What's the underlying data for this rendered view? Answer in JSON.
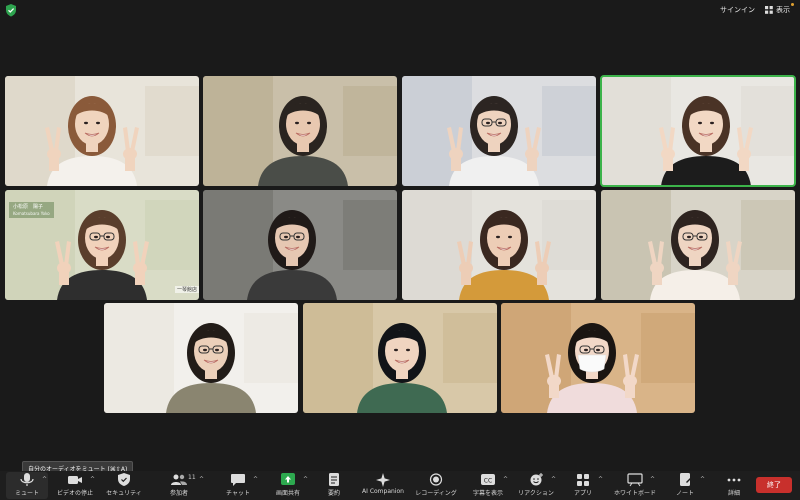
{
  "topbar": {
    "signin": "サインイン",
    "view": "表示",
    "view_icon": "grid-icon",
    "security_icon": "shield-icon"
  },
  "tiles": [
    {
      "bg": "#e8e4da",
      "wall": "#d9d2c2",
      "shirt": "#f4f1ec",
      "hair": "#8a5a3a",
      "skin": "#f0d4be",
      "glasses": false,
      "mask": false,
      "peace": true
    },
    {
      "bg": "#c9bfa9",
      "wall": "#b8ab8e",
      "shirt": "#4a4d48",
      "hair": "#2a2420",
      "skin": "#e8c8b0",
      "glasses": false,
      "mask": false,
      "peace": false
    },
    {
      "bg": "#dcdde0",
      "wall": "#c0c6ce",
      "shirt": "#f0f0f0",
      "hair": "#2c2522",
      "skin": "#eed3bf",
      "glasses": true,
      "mask": false,
      "peace": true
    },
    {
      "bg": "#e9e7e2",
      "wall": "#dddad2",
      "shirt": "#1c1c1c",
      "hair": "#4a3326",
      "skin": "#f2d8c4",
      "glasses": false,
      "mask": false,
      "peace": true,
      "active": true
    },
    {
      "bg": "#d9dcc6",
      "wall": "#c9cfb2",
      "shirt": "#2e2e2e",
      "hair": "#5a3e2c",
      "skin": "#f1d2bb",
      "glasses": true,
      "mask": false,
      "peace": true
    },
    {
      "bg": "#8a8a86",
      "wall": "#6f6f6a",
      "shirt": "#3a3a3a",
      "hair": "#201a18",
      "skin": "#e6c7b2",
      "glasses": true,
      "mask": false,
      "peace": false
    },
    {
      "bg": "#e4e2dc",
      "wall": "#d8d6cf",
      "shirt": "#d49a3a",
      "hair": "#3a2820",
      "skin": "#edcdb6",
      "glasses": false,
      "mask": false,
      "peace": true
    },
    {
      "bg": "#d8d4c8",
      "wall": "#bfb9a4",
      "shirt": "#f5efe8",
      "hair": "#2e2420",
      "skin": "#efd5c2",
      "glasses": true,
      "mask": false,
      "peace": true
    },
    {
      "bg": "#f2f0ec",
      "wall": "#e8e4dc",
      "shirt": "#8a8570",
      "hair": "#221c18",
      "skin": "#ecd0ba",
      "glasses": true,
      "mask": false,
      "peace": false
    },
    {
      "bg": "#d8c8a8",
      "wall": "#c8b48c",
      "shirt": "#3f6a52",
      "hair": "#121418",
      "skin": "#f0d4c0",
      "glasses": false,
      "mask": false,
      "peace": false
    },
    {
      "bg": "#d9b488",
      "wall": "#c89d6c",
      "shirt": "#f0dcdc",
      "hair": "#1a1512",
      "skin": "#f2d8c8",
      "glasses": true,
      "mask": true,
      "peace": true
    }
  ],
  "nametag": {
    "name": "小松原　陽子",
    "sub": "Komatsubara Yoko"
  },
  "shop_label": "一琴館店",
  "tooltip": "自分のオーディオをミュート (⌘⇧A)",
  "toolbar": {
    "items": [
      {
        "label": "ミュート",
        "icon": "microphone-icon"
      },
      {
        "label": "ビデオの停止",
        "icon": "video-camera-icon"
      },
      {
        "label": "セキュリティ",
        "icon": "shield-check-icon"
      },
      {
        "label": "参加者",
        "icon": "participants-icon",
        "count": "11"
      },
      {
        "label": "チャット",
        "icon": "chat-bubble-icon"
      },
      {
        "label": "画面共有",
        "icon": "share-screen-icon"
      },
      {
        "label": "要約",
        "icon": "summary-icon"
      },
      {
        "label": "AI Companion",
        "icon": "ai-sparkle-icon"
      },
      {
        "label": "レコーディング",
        "icon": "record-icon"
      },
      {
        "label": "字幕を表示",
        "icon": "captions-icon"
      },
      {
        "label": "リアクション",
        "icon": "reaction-icon"
      },
      {
        "label": "アプリ",
        "icon": "apps-icon"
      },
      {
        "label": "ホワイトボード",
        "icon": "whiteboard-icon"
      },
      {
        "label": "ノート",
        "icon": "notes-icon"
      },
      {
        "label": "詳細",
        "icon": "more-icon"
      }
    ],
    "end_label": "終了",
    "share_color": "#2da94f",
    "end_color": "#c8302c"
  }
}
